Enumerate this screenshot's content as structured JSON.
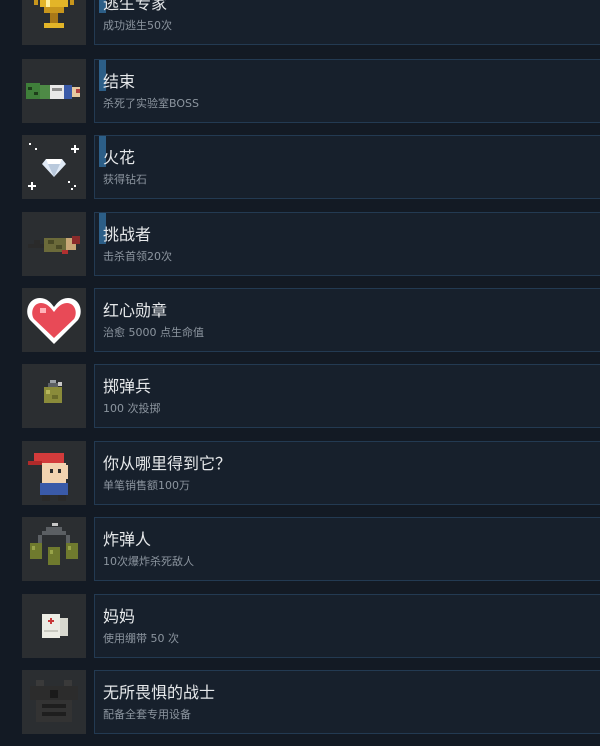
{
  "achievements": [
    {
      "title": "逃生专家",
      "desc": "成功逃生50次",
      "icon": "trophy-icon",
      "progress_bar": true
    },
    {
      "title": "结束",
      "desc": "杀死了实验室BOSS",
      "icon": "fallen-zombie-icon",
      "progress_bar": true
    },
    {
      "title": "火花",
      "desc": "获得钻石",
      "icon": "diamond-sparkle-icon",
      "progress_bar": true
    },
    {
      "title": "挑战者",
      "desc": "击杀首领20次",
      "icon": "fallen-soldier-icon",
      "progress_bar": true
    },
    {
      "title": "红心勋章",
      "desc": "治愈 5000 点生命值",
      "icon": "heart-icon",
      "progress_bar": false
    },
    {
      "title": "掷弹兵",
      "desc": "100 次投掷",
      "icon": "grenade-icon",
      "progress_bar": false
    },
    {
      "title": "你从哪里得到它？",
      "desc": "单笔销售额100万",
      "icon": "red-cap-character-icon",
      "progress_bar": false
    },
    {
      "title": "炸弹人",
      "desc": "10次爆炸杀死敌人",
      "icon": "triple-grenade-icon",
      "progress_bar": false
    },
    {
      "title": "妈妈",
      "desc": "使用绷带 50 次",
      "icon": "bandage-icon",
      "progress_bar": false
    },
    {
      "title": "无所畏惧的战士",
      "desc": "配备全套专用设备",
      "icon": "armor-vest-icon",
      "progress_bar": false
    }
  ],
  "colors": {
    "background": "#131a24",
    "panel": "#17202c",
    "panel_border": "#233a52",
    "progress_accent": "#2c5e87",
    "title_text": "#e6e8ea",
    "desc_text": "#8c959f",
    "icon_bg": "#2b2e31"
  }
}
